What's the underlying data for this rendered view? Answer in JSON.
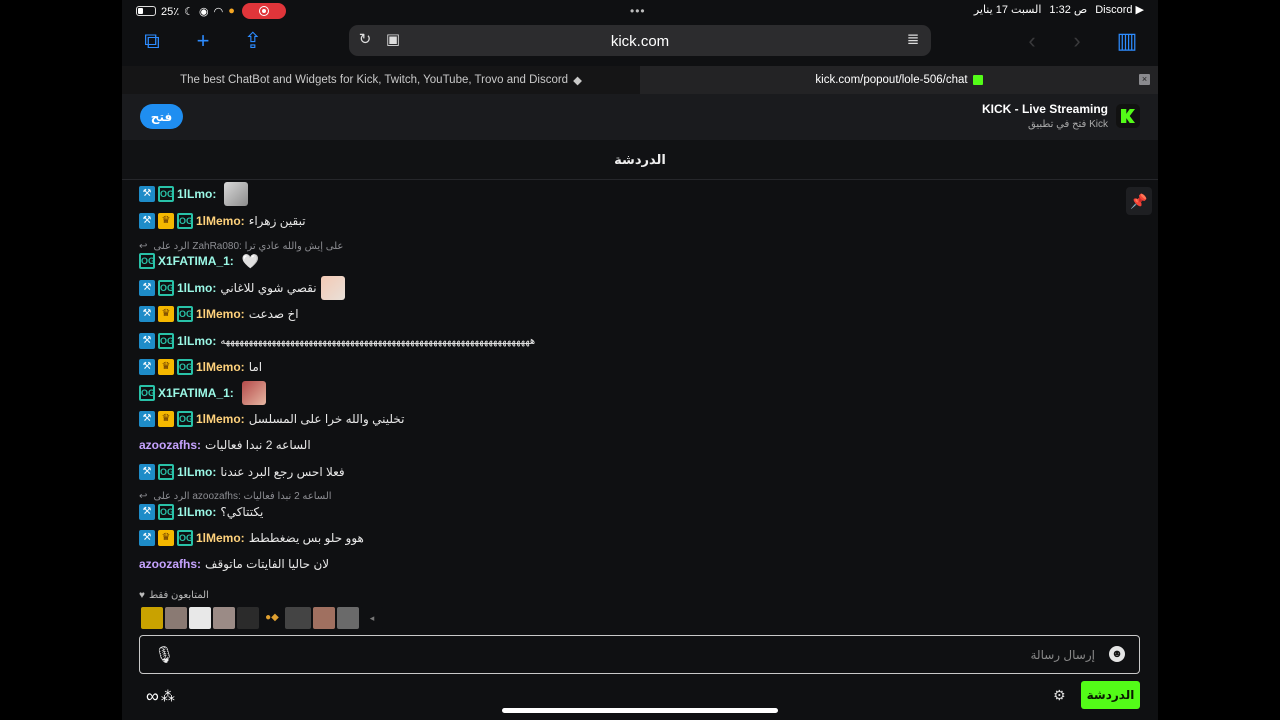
{
  "status": {
    "battery": "25٪",
    "time": "1:32 ص",
    "date": "السبت 17 يناير",
    "back_app": "Discord ▶",
    "ellipsis": "•••"
  },
  "toolbar": {
    "url": "kick.com"
  },
  "tabs": [
    {
      "label": "The best ChatBot and Widgets for Kick, Twitch, YouTube, Trovo and Discord"
    },
    {
      "label": "kick.com/popout/lole-506/chat"
    }
  ],
  "banner": {
    "open_label": "فتح",
    "app_title": "KICK - Live Streaming",
    "app_sub": "فتح في تطبيق Kick"
  },
  "chat": {
    "title": "الدردشة",
    "messages": [
      {
        "user": "1lLmo:",
        "text": ""
      },
      {
        "user": "1lMemo:",
        "text": "تبقين زهراء"
      },
      {
        "reply": "الرد على ZahRa080: على إيش والله عادي ترا"
      },
      {
        "user": "X1FATIMA_1:",
        "text": ""
      },
      {
        "user": "1lLmo:",
        "text": "نقصي شوي للاغاني"
      },
      {
        "user": "1lMemo:",
        "text": "اخ صدعت"
      },
      {
        "user": "1lLmo:",
        "text": "هههههههههههههههههههههههههههههههههههههههههههههههههههههههههههههههههههه"
      },
      {
        "user": "1lMemo:",
        "text": "اما"
      },
      {
        "user": "X1FATIMA_1:",
        "text": ""
      },
      {
        "user": "1lMemo:",
        "text": "تخليني والله خرا على المسلسل"
      },
      {
        "user": "azoozafhs:",
        "text": "الساعه 2 نبدا فعاليات"
      },
      {
        "user": "1lLmo:",
        "text": "فعلا احس رجع البرد عندنا"
      },
      {
        "reply": "الرد على azoozafhs: الساعه 2 نبدا فعاليات"
      },
      {
        "user": "1lLmo:",
        "text": "يكتتاكي؟"
      },
      {
        "user": "1lMemo:",
        "text": "هوو حلو بس يضغططط"
      },
      {
        "user": "azoozafhs:",
        "text": "لان حاليا الفايتات ماتوقف"
      }
    ],
    "followers_only": "المتابعون فقط",
    "input_placeholder": "إرسال رسالة",
    "chat_button": "الدردشة"
  },
  "colors": {
    "kick_green": "#53fc18",
    "safari_blue": "#2d8cff",
    "open_blue": "#1f8ef1"
  },
  "icons": [
    "tabs-icon",
    "plus-icon",
    "share-icon",
    "reload-icon",
    "reader-icon",
    "back-icon",
    "forward-icon",
    "sidebar-icon",
    "close-icon",
    "pin-icon",
    "mic-icon",
    "smile-icon",
    "gear-icon",
    "heart-icon"
  ]
}
